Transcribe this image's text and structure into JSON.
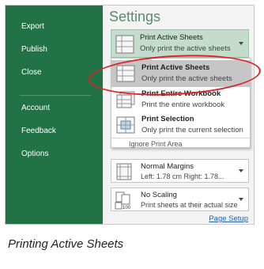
{
  "sidebar": {
    "items": [
      {
        "label": "Export"
      },
      {
        "label": "Publish"
      },
      {
        "label": "Close"
      },
      {
        "label": "Account"
      },
      {
        "label": "Feedback"
      },
      {
        "label": "Options"
      }
    ]
  },
  "settings": {
    "title": "Settings",
    "print_what": {
      "title": "Print Active Sheets",
      "subtitle": "Only print the active sheets"
    },
    "menu": {
      "items": [
        {
          "title": "Print Active Sheets",
          "subtitle": "Only print the active sheets"
        },
        {
          "title": "Print Entire Workbook",
          "subtitle": "Print the entire workbook"
        },
        {
          "title": "Print Selection",
          "subtitle": "Only print the current selection"
        }
      ],
      "ignore_print_area": "Ignore Print Area"
    },
    "margins": {
      "title": "Normal Margins",
      "detail": "Left:  1.78 cm    Right:  1.78..."
    },
    "scaling": {
      "title": "No Scaling",
      "detail": "Print sheets at their actual size",
      "icon_label": "100"
    },
    "page_setup": "Page Setup"
  },
  "caption": "Printing Active Sheets",
  "colors": {
    "sidebar_bg": "#217346",
    "highlight_ellipse": "#e0202a",
    "selected_button": "#c3dccb",
    "link": "#1f5fb0"
  }
}
